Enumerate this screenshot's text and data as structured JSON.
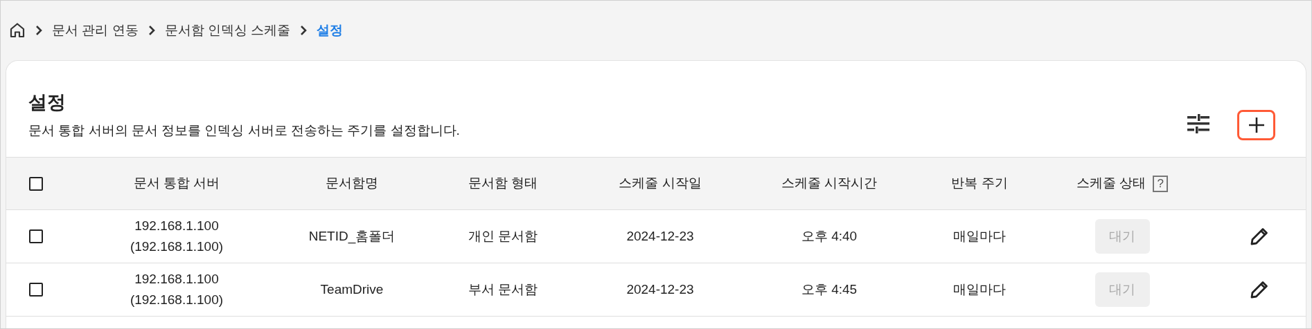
{
  "breadcrumb": [
    {
      "label": "문서 관리 연동",
      "current": false
    },
    {
      "label": "문서함 인덱싱 스케줄",
      "current": false
    },
    {
      "label": "설정",
      "current": true
    }
  ],
  "header": {
    "title": "설정",
    "description": "문서 통합 서버의 문서 정보를 인덱싱 서버로 전송하는 주기를 설정합니다."
  },
  "table": {
    "select_all": {
      "checked": false
    },
    "status_help": "?",
    "columns": [
      "문서 통합 서버",
      "문서함명",
      "문서함 형태",
      "스케줄 시작일",
      "스케줄 시작시간",
      "반복 주기",
      "스케줄 상태"
    ],
    "rows": [
      {
        "checked": false,
        "server": "192.168.1.100",
        "server_detail": "(192.168.1.100)",
        "name": "NETID_홈폴더",
        "type": "개인 문서함",
        "start_date": "2024-12-23",
        "start_time": "오후 4:40",
        "repeat": "매일마다",
        "status": {
          "label": "대기",
          "disabled": true
        }
      },
      {
        "checked": false,
        "server": "192.168.1.100",
        "server_detail": "(192.168.1.100)",
        "name": "TeamDrive",
        "type": "부서 문서함",
        "start_date": "2024-12-23",
        "start_time": "오후 4:45",
        "repeat": "매일마다",
        "status": {
          "label": "대기",
          "disabled": true
        }
      }
    ]
  }
}
